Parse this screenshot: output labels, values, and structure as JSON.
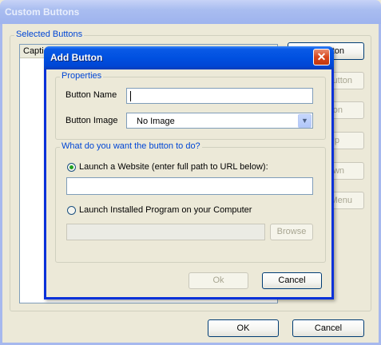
{
  "outer_window": {
    "title": "Custom Buttons",
    "group_label": "Selected Buttons",
    "list_header": "Capti",
    "side_buttons": [
      "ton",
      "utton",
      "on",
      "Up",
      "wn",
      "Menu"
    ],
    "ok_label": "OK",
    "cancel_label": "Cancel"
  },
  "dialog": {
    "title": "Add Button",
    "close_glyph": "✕",
    "properties": {
      "legend": "Properties",
      "name_label": "Button Name",
      "name_value": "",
      "image_label": "Button Image",
      "image_value": "No Image",
      "dropdown_glyph": "▼"
    },
    "action": {
      "legend": "What do you want the button to do?",
      "website_label": "Launch a Website (enter full path to URL below):",
      "website_selected": true,
      "url_value": "",
      "program_label": "Launch Installed Program on your Computer",
      "program_selected": false,
      "program_path_value": "",
      "browse_label": "Browse"
    },
    "ok_label": "Ok",
    "cancel_label": "Cancel"
  },
  "colors": {
    "accent": "#0046d5",
    "title_active": "#0050e0",
    "radio_selected": "#21a121"
  },
  "icons": {
    "close": "close-icon",
    "dropdown": "chevron-down-icon"
  }
}
